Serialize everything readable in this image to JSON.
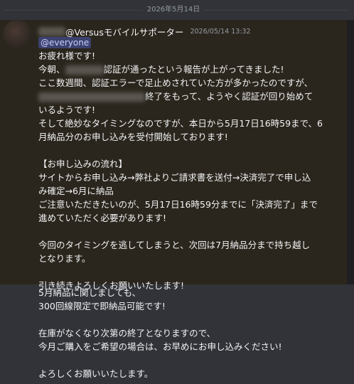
{
  "date_divider": "2026年5月14日",
  "author": {
    "name": "@Versusモバイルサポーター",
    "timestamp": "2026/05/14 13:32"
  },
  "mention": "@everyone",
  "lines": [
    "お疲れ様です!",
    "今朝、",
    "認証が通ったという報告が上がってきました!",
    "ここ数週間、認証エラーで足止めされていた方が多かったのですが、",
    "終了をもって、ようやく認証が回り始めて",
    "いるようです!",
    "そして絶妙なタイミングなのですが、本日から5月17日16時59まで、6",
    "月納品分のお申し込みを受付開始しております!",
    "",
    "【お申し込みの流れ】",
    "サイトからお申し込み→弊社よりご請求書を送付→決済完了で申し込",
    "み確定→6月に納品",
    "ご注意いただきたいのが、5月17日16時59分までに「決済完了」まで",
    "進めていただく必要があります!",
    "",
    "今回のタイミングを逃してしまうと、次回は7月納品分まで持ち越し",
    "となります。",
    "",
    "引き続きよろしくお願いいたします!",
    "5月納品に関しましても、",
    "300回線限定で即納品可能です!",
    "",
    "在庫がなくなり次第の終了となりますので、",
    "今月ご購入をご希望の場合は、お早めにお申し込みください!",
    "",
    "よろしくお願いいたします。"
  ]
}
